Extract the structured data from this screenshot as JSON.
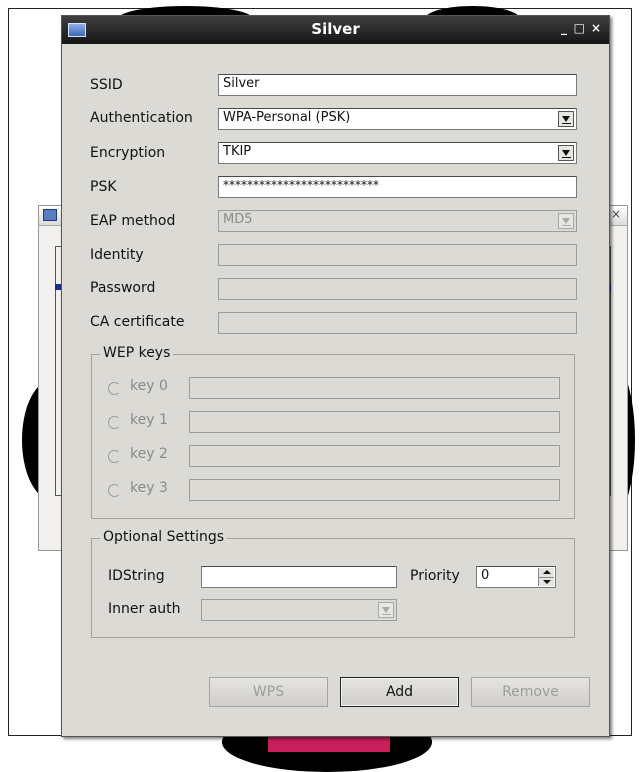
{
  "dialog": {
    "title": "Silver",
    "btn_min": "_",
    "btn_max": "□",
    "btn_close": "×"
  },
  "background_window": {
    "close": "×"
  },
  "form": {
    "ssid": {
      "label": "SSID",
      "value": "Silver"
    },
    "auth": {
      "label": "Authentication",
      "value": "WPA-Personal (PSK)"
    },
    "encryption": {
      "label": "Encryption",
      "value": "TKIP"
    },
    "psk": {
      "label": "PSK",
      "value": "**************************"
    },
    "eap": {
      "label": "EAP method",
      "value": "MD5"
    },
    "identity": {
      "label": "Identity",
      "value": ""
    },
    "password": {
      "label": "Password",
      "value": ""
    },
    "ca_cert": {
      "label": "CA certificate",
      "value": ""
    }
  },
  "wep": {
    "title": "WEP keys",
    "keys": [
      {
        "label": "key 0",
        "value": ""
      },
      {
        "label": "key 1",
        "value": ""
      },
      {
        "label": "key 2",
        "value": ""
      },
      {
        "label": "key 3",
        "value": ""
      }
    ]
  },
  "optional": {
    "title": "Optional Settings",
    "idstring_label": "IDString",
    "idstring_value": "",
    "priority_label": "Priority",
    "priority_value": "0",
    "inner_auth_label": "Inner auth",
    "inner_auth_value": ""
  },
  "buttons": {
    "wps": "WPS",
    "add": "Add",
    "remove": "Remove"
  },
  "colors": {
    "titlebar": "#1f1f1f",
    "dialog_bg": "#dcdad5",
    "wallpaper_accent": "#c81e5c"
  },
  "icons": {
    "window_icon": "window-icon"
  }
}
